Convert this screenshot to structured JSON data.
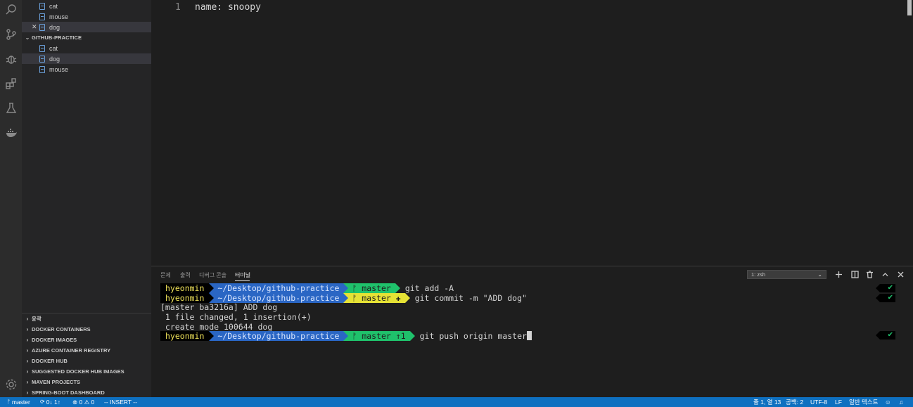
{
  "explorer": {
    "open_editors": [
      {
        "name": "cat",
        "dirty_close": false
      },
      {
        "name": "mouse",
        "dirty_close": false
      },
      {
        "name": "dog",
        "dirty_close": true
      }
    ],
    "folder_name": "GITHUB-PRACTICE",
    "files": [
      "cat",
      "dog",
      "mouse"
    ],
    "selected_file": "dog",
    "sections": [
      "윤곽",
      "DOCKER CONTAINERS",
      "DOCKER IMAGES",
      "AZURE CONTAINER REGISTRY",
      "DOCKER HUB",
      "SUGGESTED DOCKER HUB IMAGES",
      "MAVEN PROJECTS",
      "SPRING-BOOT DASHBOARD"
    ]
  },
  "activity_bar": {
    "icons": [
      "search-icon",
      "source-control-icon",
      "debug-icon",
      "extensions-icon",
      "testing-icon",
      "docker-icon",
      "settings-gear-icon"
    ]
  },
  "editor": {
    "line_number": "1",
    "line_text": "name: snoopy"
  },
  "panel": {
    "tabs": [
      "문제",
      "출력",
      "디버그 콘솔",
      "터미널"
    ],
    "active_tab": "터미널",
    "terminal_select": "1: zsh"
  },
  "terminal": {
    "prompts": [
      {
        "user": "hyeonmin",
        "path": "~/Desktop/github-practice",
        "git": "ᚠ master",
        "git_color": "#1fc16b",
        "command": "git add -A"
      },
      {
        "user": "hyeonmin",
        "path": "~/Desktop/github-practice",
        "git": "ᚠ master ✚",
        "git_color": "#e6e235",
        "command": "git commit -m \"ADD dog\""
      },
      {
        "user": "hyeonmin",
        "path": "~/Desktop/github-practice",
        "git": "ᚠ master ↑1",
        "git_color": "#1fc16b",
        "command": "git push origin master"
      }
    ],
    "output": [
      "[master ba3216a] ADD dog",
      " 1 file changed, 1 insertion(+)",
      " create mode 100644 dog"
    ],
    "check_mark": "✔"
  },
  "status_bar": {
    "branch": "master",
    "sync": "0↓ 1↑",
    "problems": "⊗ 0 ⚠ 0",
    "mode": "-- INSERT --",
    "cursor_pos": "줄 1, 열 13",
    "spaces": "공백: 2",
    "encoding": "UTF-8",
    "eol": "LF",
    "language": "일반 텍스트"
  },
  "colors": {
    "status_bar": "#0e70c0",
    "path_segment": "#2a66c4",
    "user_segment_text": "#f0e35a"
  }
}
